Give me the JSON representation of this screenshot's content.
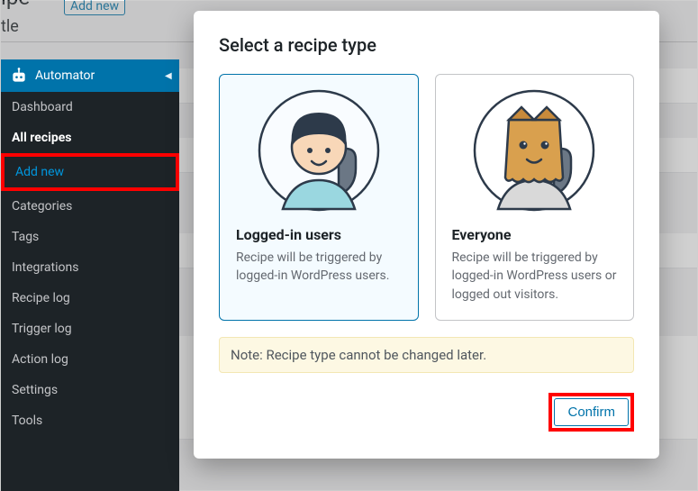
{
  "background": {
    "page_heading_fragment": "ipe",
    "add_new_button": "Add new",
    "title_fragment": "tle"
  },
  "sidebar": {
    "header": "Automator",
    "items": [
      {
        "label": "Dashboard",
        "bold": false,
        "active": false,
        "highlight": false
      },
      {
        "label": "All recipes",
        "bold": true,
        "active": false,
        "highlight": false
      },
      {
        "label": "Add new",
        "bold": false,
        "active": true,
        "highlight": true
      },
      {
        "label": "Categories",
        "bold": false,
        "active": false,
        "highlight": false
      },
      {
        "label": "Tags",
        "bold": false,
        "active": false,
        "highlight": false
      },
      {
        "label": "Integrations",
        "bold": false,
        "active": false,
        "highlight": false
      },
      {
        "label": "Recipe log",
        "bold": false,
        "active": false,
        "highlight": false
      },
      {
        "label": "Trigger log",
        "bold": false,
        "active": false,
        "highlight": false
      },
      {
        "label": "Action log",
        "bold": false,
        "active": false,
        "highlight": false
      },
      {
        "label": "Settings",
        "bold": false,
        "active": false,
        "highlight": false
      },
      {
        "label": "Tools",
        "bold": false,
        "active": false,
        "highlight": false
      }
    ]
  },
  "modal": {
    "title": "Select a recipe type",
    "cards": [
      {
        "title": "Logged-in users",
        "description": "Recipe will be triggered by logged-in WordPress users.",
        "selected": true
      },
      {
        "title": "Everyone",
        "description": "Recipe will be triggered by logged-in WordPress users or logged out visitors.",
        "selected": false
      }
    ],
    "note": "Note: Recipe type cannot be changed later.",
    "confirm_label": "Confirm"
  },
  "colors": {
    "wp_blue": "#0073aa",
    "sidebar_bg": "#1d2327",
    "highlight_red": "#ff0000",
    "note_bg": "#fdf8e3"
  }
}
